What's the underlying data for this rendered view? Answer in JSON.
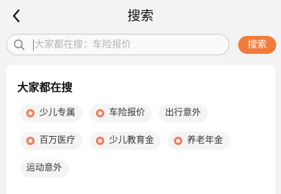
{
  "header": {
    "title": "搜索",
    "back_icon": "chevron-left-icon"
  },
  "search": {
    "placeholder": "大家都在搜：车险报价",
    "value": "",
    "button_label": "搜索",
    "icon": "search-icon",
    "button_color": "#f17b3b"
  },
  "hot": {
    "title": "大家都在搜",
    "tags": [
      {
        "label": "少儿专属",
        "hot": true
      },
      {
        "label": "车险报价",
        "hot": true
      },
      {
        "label": "出行意外",
        "hot": false
      },
      {
        "label": "百万医疗",
        "hot": true
      },
      {
        "label": "少儿教育金",
        "hot": true
      },
      {
        "label": "养老年金",
        "hot": true
      },
      {
        "label": "运动意外",
        "hot": false
      }
    ]
  }
}
